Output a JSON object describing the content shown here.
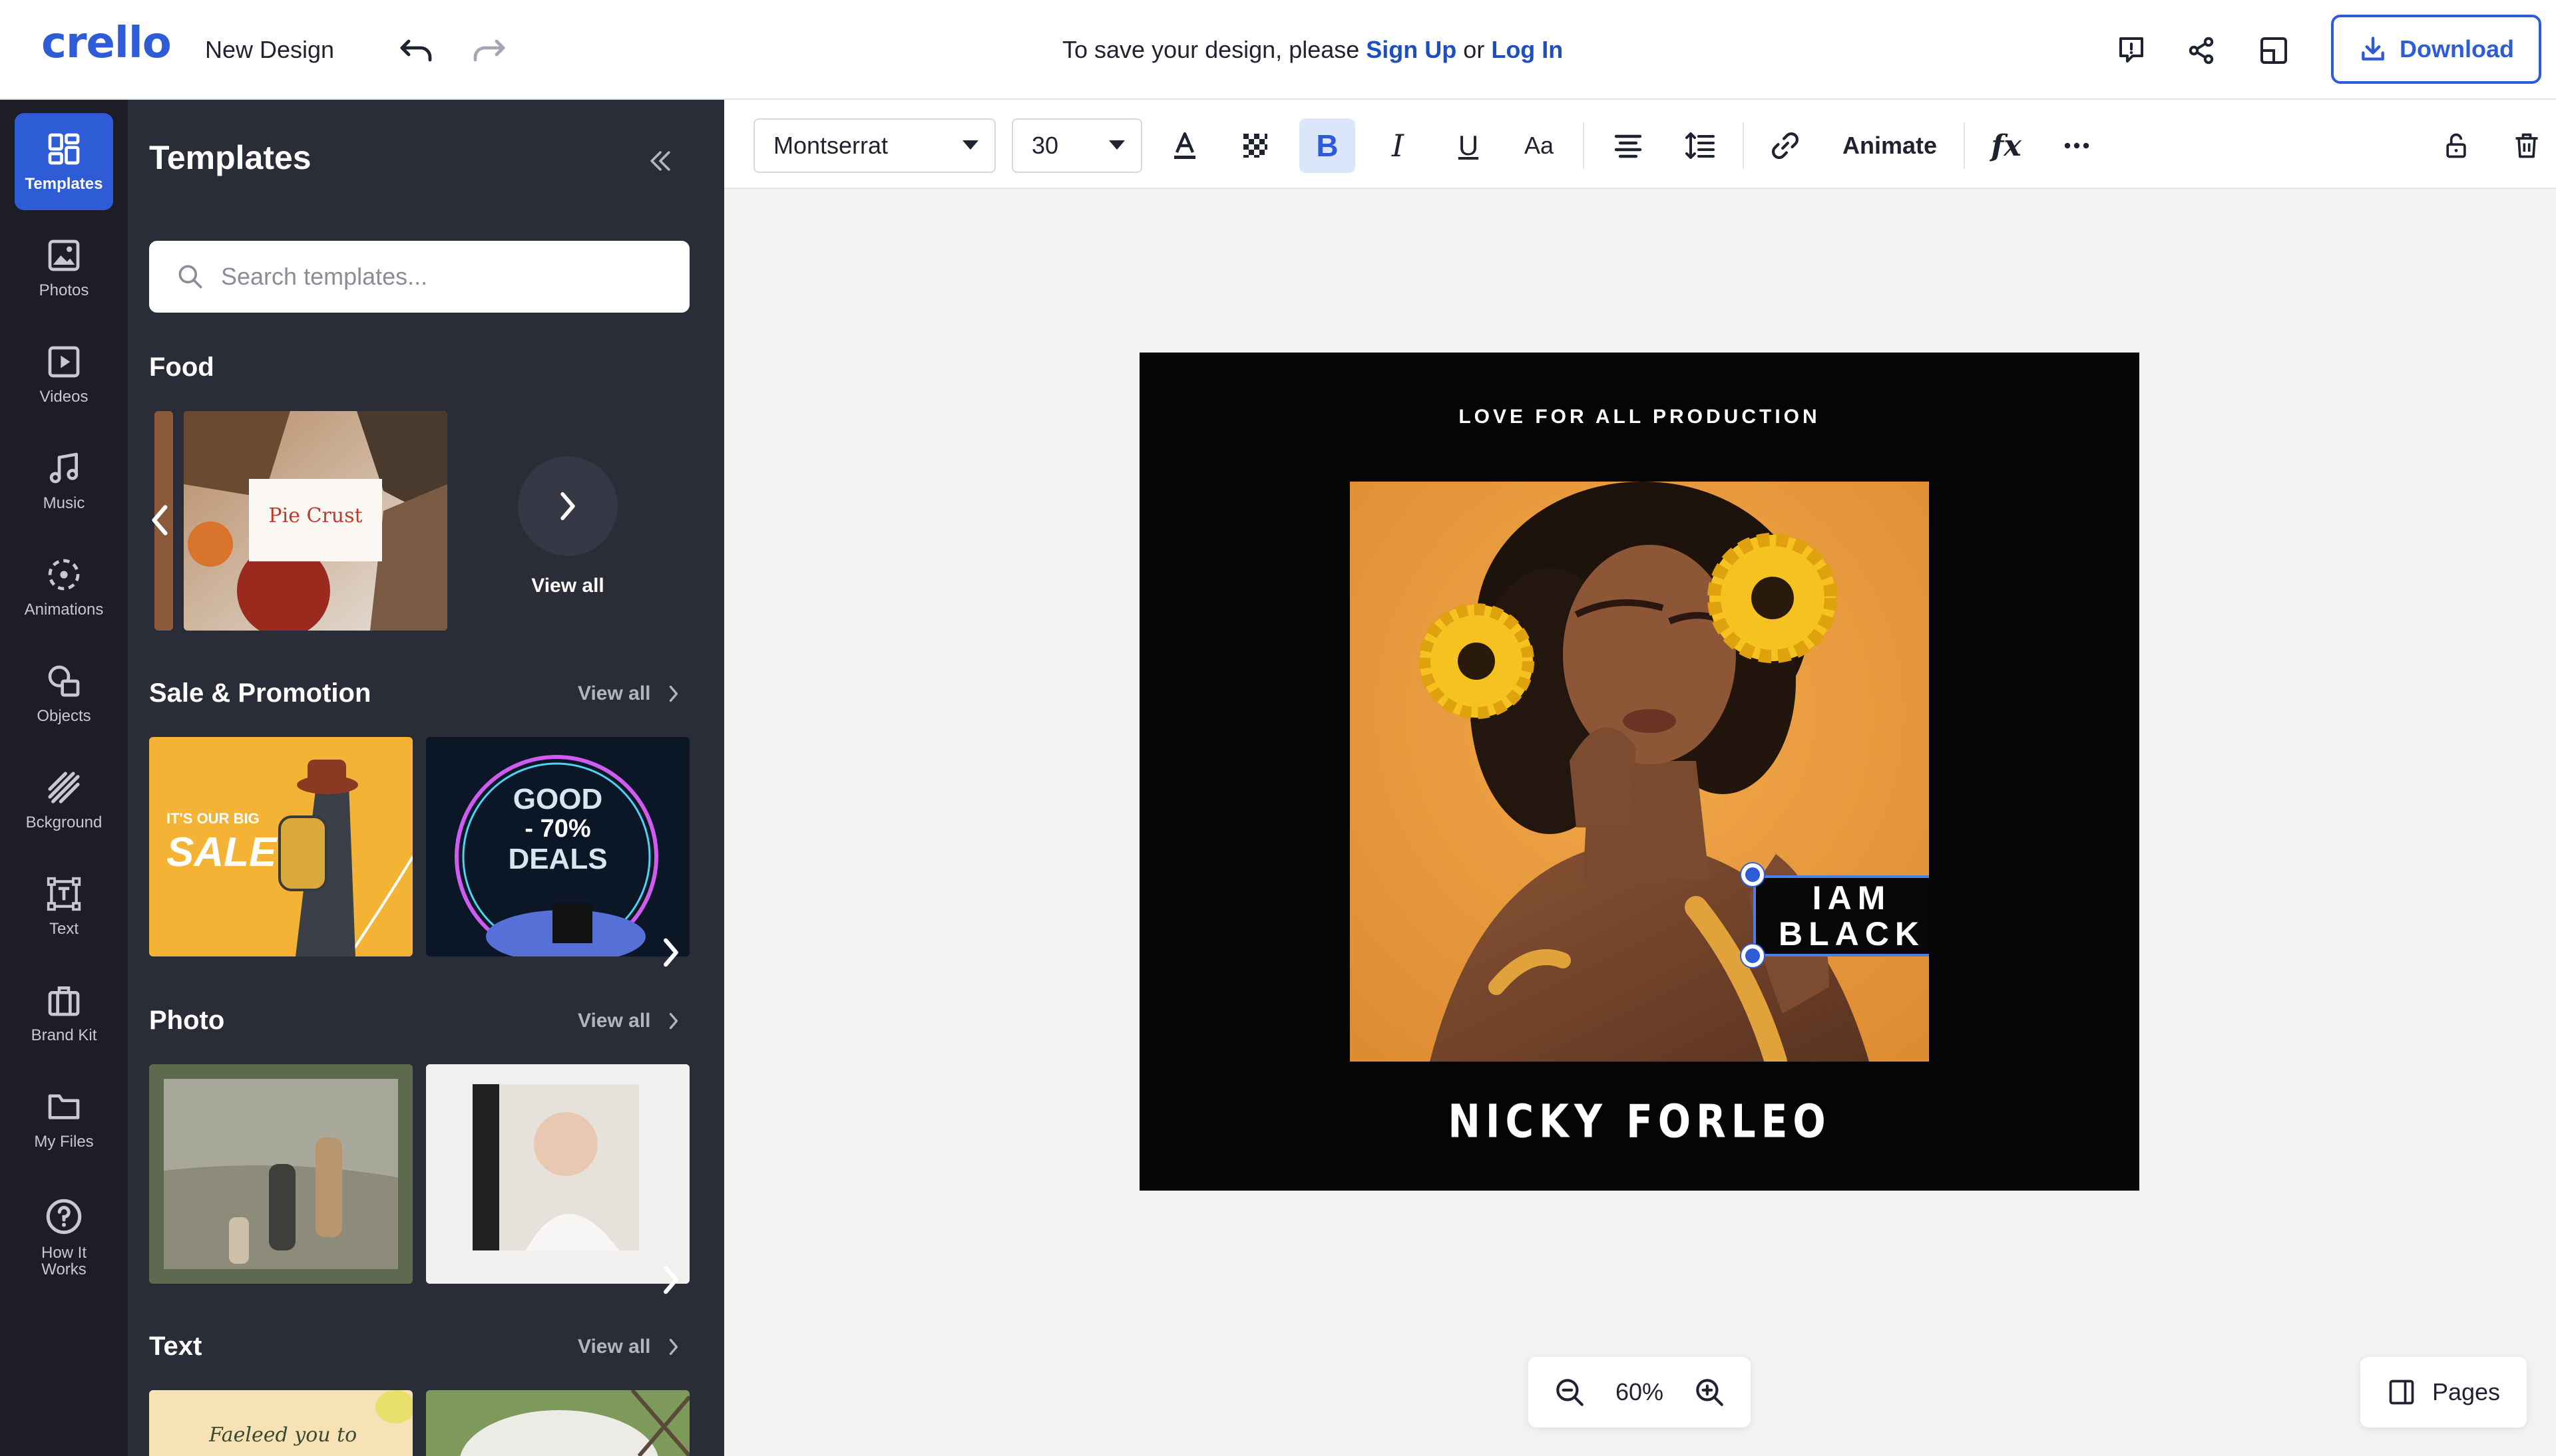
{
  "header": {
    "logo": "crello",
    "design_name": "New Design",
    "save_prefix": "To save your design, please",
    "sign_up": "Sign Up",
    "or": "or",
    "log_in": "Log In",
    "download_label": "Download"
  },
  "rail": {
    "items": [
      {
        "label": "Templates",
        "icon": "templates-icon",
        "active": true
      },
      {
        "label": "Photos",
        "icon": "photos-icon"
      },
      {
        "label": "Videos",
        "icon": "videos-icon"
      },
      {
        "label": "Music",
        "icon": "music-icon"
      },
      {
        "label": "Animations",
        "icon": "animations-icon"
      },
      {
        "label": "Objects",
        "icon": "objects-icon"
      },
      {
        "label": "Bckground",
        "icon": "background-icon"
      },
      {
        "label": "Text",
        "icon": "text-icon"
      },
      {
        "label": "Brand Kit",
        "icon": "brand-kit-icon"
      },
      {
        "label": "My Files",
        "icon": "folder-icon"
      },
      {
        "label": "How It Works",
        "icon": "help-icon"
      }
    ]
  },
  "panel": {
    "title": "Templates",
    "search_placeholder": "Search templates...",
    "sections": [
      {
        "title": "Food",
        "view_all": "View all",
        "pie_title": "Pie Crust"
      },
      {
        "title": "Sale & Promotion",
        "view_all": "View all",
        "sale_text": "SALE",
        "sale_small": "IT'S OUR BIG",
        "deal_line1": "GOOD",
        "deal_line2": "- 70%",
        "deal_line3": "DEALS"
      },
      {
        "title": "Photo",
        "view_all": "View all"
      },
      {
        "title": "Text",
        "view_all": "View all",
        "text_preview": "Faeleed you to"
      }
    ]
  },
  "toolbar": {
    "font": "Montserrat",
    "size": "30",
    "bold": "B",
    "italic": "I",
    "underline": "U",
    "case": "Aa",
    "animate": "Animate",
    "effects": "fx"
  },
  "canvas": {
    "subtitle": "LOVE FOR ALL PRODUCTION",
    "selected_text_line1": "IAM",
    "selected_text_line2": "BLACK",
    "name": "NICKY FORLEO",
    "photo_bg": "#e89a3c"
  },
  "zoom": {
    "value": "60%"
  },
  "pages": {
    "label": "Pages"
  },
  "colors": {
    "accent": "#2e5cd7",
    "rail_bg": "#1c1d26",
    "panel_bg": "#2a2c37"
  }
}
